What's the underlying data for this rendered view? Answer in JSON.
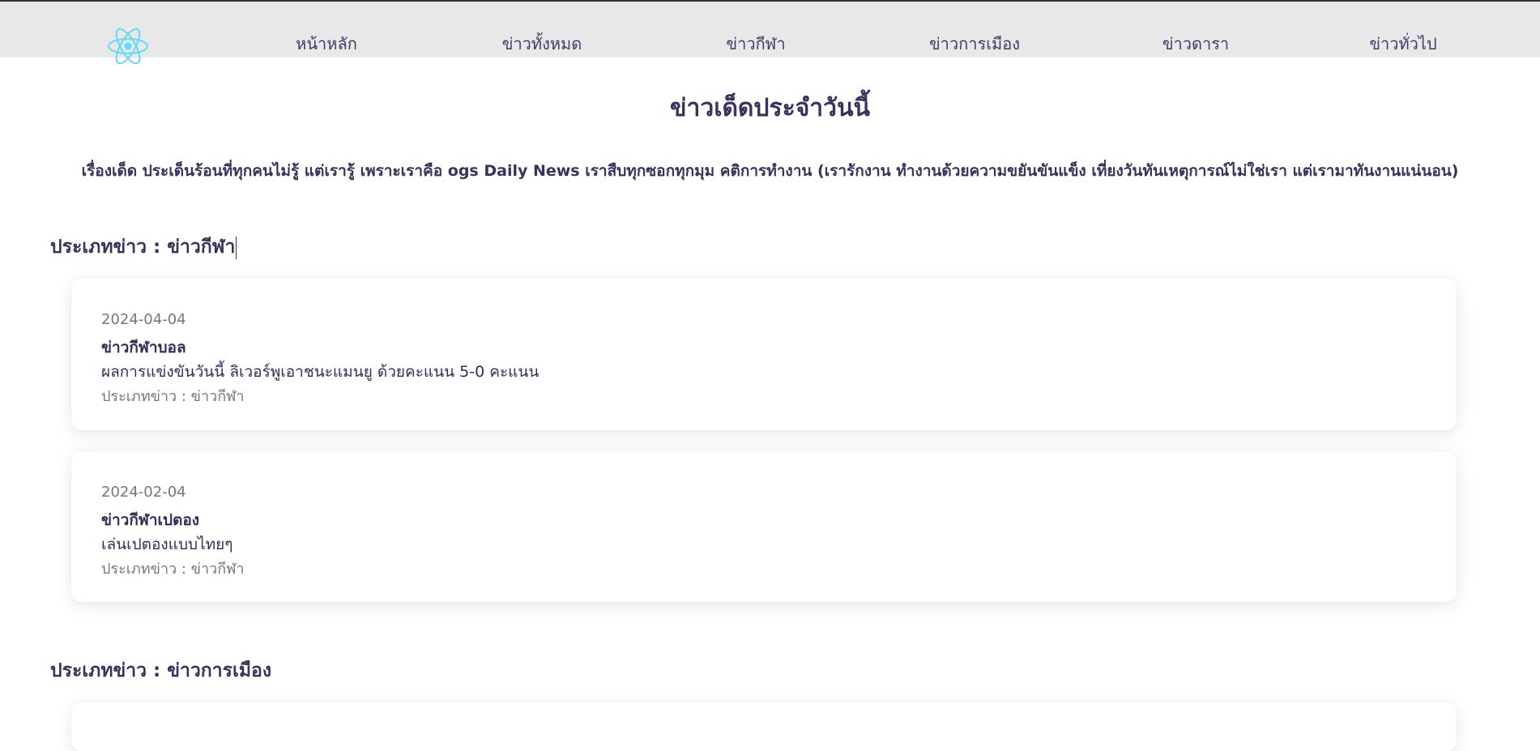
{
  "nav": {
    "logo_icon": "react-atom-icon",
    "logo_color": "#61dafb",
    "items": [
      {
        "label": "หน้าหลัก"
      },
      {
        "label": "ข่าวทั้งหมด"
      },
      {
        "label": "ข่าวกีฬา"
      },
      {
        "label": "ข่าวการเมือง"
      },
      {
        "label": "ข่าวดารา"
      },
      {
        "label": "ข่าวทั่วไป"
      }
    ]
  },
  "page": {
    "title": "ข่าวเด็ดประจำวันนี้",
    "intro": "เรื่องเด็ด ประเด็นร้อนที่ทุกคนไม่รู้ แต่เรารู้ เพราะเราคือ ogs Daily News เราสืบทุกซอกทุกมุม คติการทำงาน (เรารักงาน ทำงานด้วยความขยันขันแข็ง เที่ยงวันทันเหตุการณ์ไม่ใช่เรา แต่เรามาทันงานแน่นอน)"
  },
  "sections": [
    {
      "heading": "ประเภทข่าว : ข่าวกีฬา",
      "articles": [
        {
          "date": "2024-04-04",
          "title": "ข่าวกีฬาบอล",
          "body": "ผลการแข่งขันวันนี้ ลิเวอร์พูเอาชนะแมนยู ด้วยคะแนน 5-0 คะแนน",
          "category": "ประเภทข่าว : ข่าวกีฬา"
        },
        {
          "date": "2024-02-04",
          "title": "ข่าวกีฬาเปตอง",
          "body": "เล่นเปตองแบบไทยๆ",
          "category": "ประเภทข่าว : ข่าวกีฬา"
        }
      ]
    },
    {
      "heading": "ประเภทข่าว : ข่าวการเมือง",
      "articles": []
    }
  ]
}
